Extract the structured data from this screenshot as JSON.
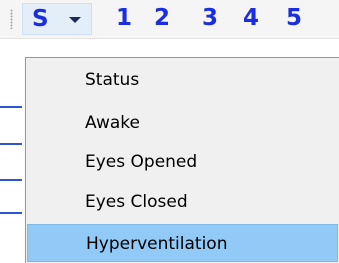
{
  "toolbar": {
    "dropdown_label": "S",
    "dropdown_icon": "chevron-down-icon",
    "numbers": [
      "1",
      "2",
      "3",
      "4",
      "5"
    ]
  },
  "menu": {
    "items": [
      {
        "label": "Status"
      },
      {
        "label": "Awake"
      },
      {
        "label": "Eyes Opened"
      },
      {
        "label": "Eyes Closed"
      },
      {
        "label": "Hyperventilation",
        "highlighted": true
      }
    ]
  },
  "colors": {
    "glyph_blue": "#1a2ee0",
    "menu_background": "#f0f0f0",
    "highlight": "#91c9f7",
    "button_hover": "#e3eef9"
  }
}
